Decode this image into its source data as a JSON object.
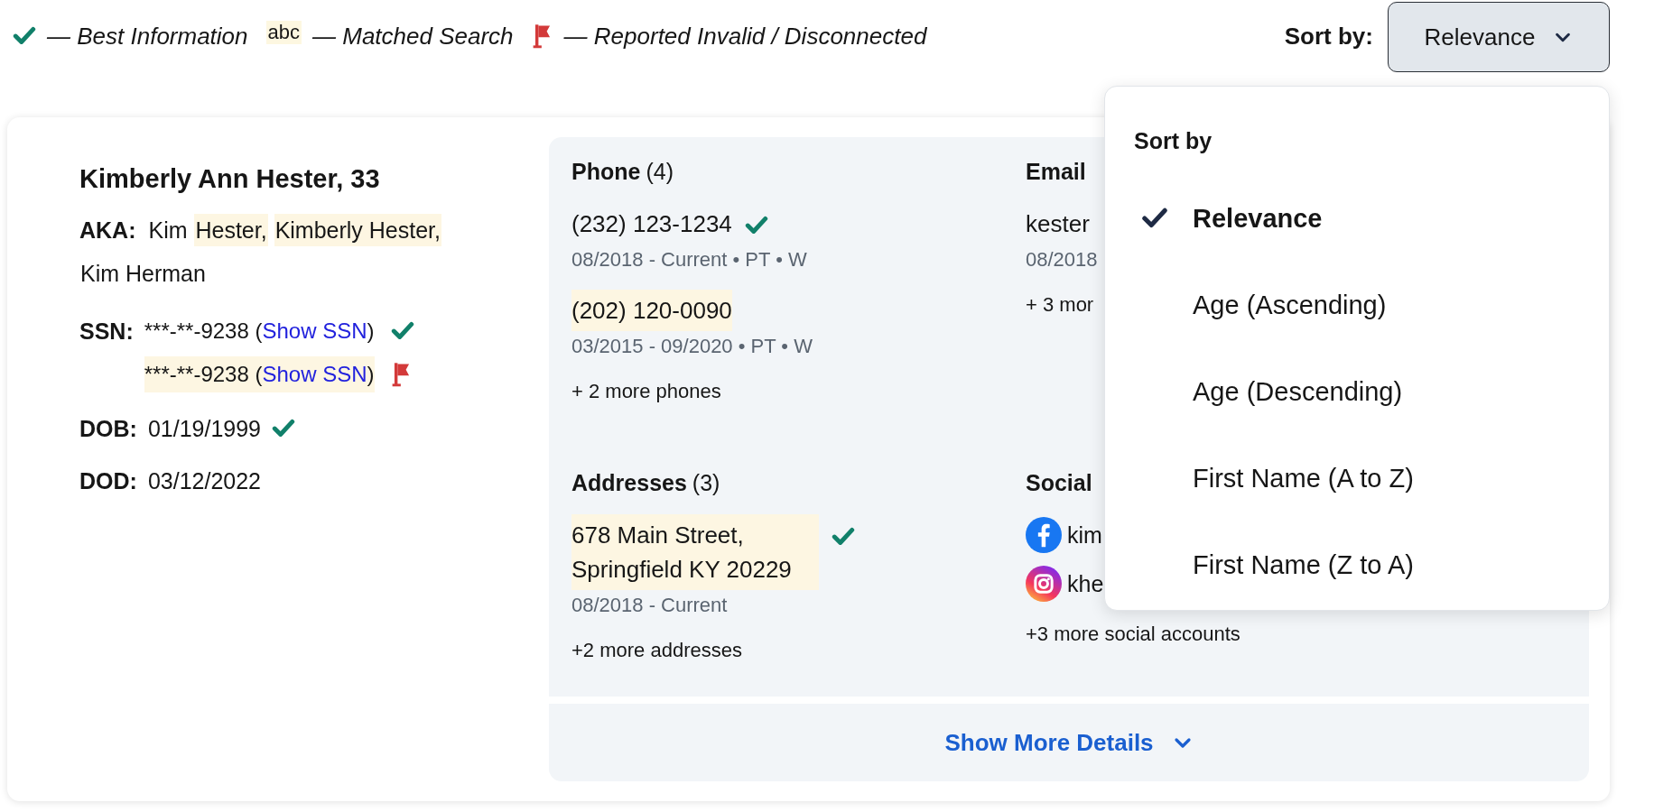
{
  "legend": [
    {
      "kind": "check",
      "label": "— Best Information"
    },
    {
      "kind": "match",
      "sample": "abc",
      "label": "— Matched Search"
    },
    {
      "kind": "flag",
      "label": "— Reported Invalid / Disconnected"
    }
  ],
  "sort": {
    "label": "Sort by:",
    "value": "Relevance",
    "expanded": true
  },
  "sort_menu": {
    "title": "Sort by",
    "options": [
      {
        "label": "Relevance",
        "selected": true
      },
      {
        "label": "Age (Ascending)",
        "selected": false
      },
      {
        "label": "Age (Descending)",
        "selected": false
      },
      {
        "label": "First Name (A to Z)",
        "selected": false
      },
      {
        "label": "First Name (Z to A)",
        "selected": false
      }
    ]
  },
  "person": {
    "name": "Kimberly Ann Hester, 33",
    "aka": {
      "label": "AKA:",
      "parts": [
        {
          "text": "Kim",
          "matched": false
        },
        {
          "text": "Hester,",
          "matched": true
        },
        {
          "text": "Kimberly Hester,",
          "matched": true
        },
        {
          "text": "Kim Herman",
          "matched": false
        }
      ]
    },
    "ssn": {
      "label": "SSN:",
      "entries": [
        {
          "prefix": "***-**-9238 (",
          "link": "Show SSN",
          "suffix": ")",
          "matched": false,
          "verified": true,
          "flagged": false
        },
        {
          "prefix": "***-**-9238 (",
          "link": "Show SSN",
          "suffix": ")",
          "matched": true,
          "verified": false,
          "flagged": true
        }
      ]
    },
    "dob": {
      "label": "DOB:",
      "value": "01/19/1999",
      "verified": true,
      "flagged": false
    },
    "dod": {
      "label": "DOD:",
      "value": "03/12/2022",
      "verified": false,
      "flagged": false
    }
  },
  "details": {
    "sections": [
      {
        "title": "Phone",
        "count": "(4)",
        "items": [
          {
            "lines": [
              "(232) 123-1234"
            ],
            "meta": "08/2018 - Current • PT • W",
            "matched": false,
            "verified": true,
            "flagged": false
          },
          {
            "lines": [
              "(202) 120-0090"
            ],
            "meta": "03/2015 - 09/2020 • PT • W",
            "matched": true,
            "verified": false,
            "flagged": false
          }
        ],
        "more": "+ 2 more phones"
      },
      {
        "title": "Email",
        "items": [
          {
            "lines": [
              "kester"
            ],
            "meta": "08/2018",
            "matched": false,
            "verified": false,
            "flagged": false
          }
        ],
        "more": "+ 3 mor"
      },
      {
        "title": "Addresses",
        "count": "(3)",
        "items": [
          {
            "lines": [
              "678 Main Street,",
              "Springfield KY 20229"
            ],
            "meta": "08/2018 - Current",
            "matched": true,
            "verified": true,
            "flagged": false
          }
        ],
        "more": "+2 more addresses"
      },
      {
        "title": "Social",
        "items": [
          {
            "kind": "facebook",
            "lines": [
              "kim"
            ],
            "matched": false,
            "verified": false,
            "flagged": false
          },
          {
            "kind": "instagram",
            "lines": [
              "khe"
            ],
            "matched": false,
            "verified": false,
            "flagged": false
          }
        ],
        "more": "+3 more social accounts"
      }
    ],
    "show_more": "Show More Details"
  }
}
